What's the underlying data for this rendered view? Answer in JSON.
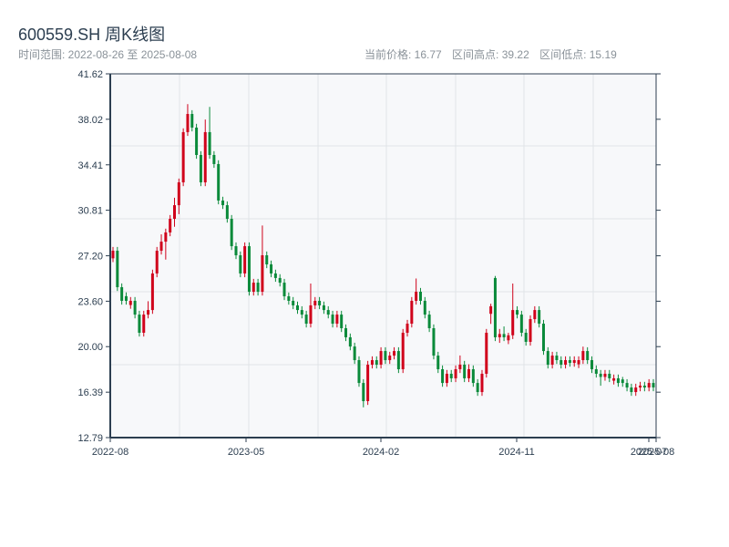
{
  "header": {
    "title": "600559.SH 周K线图",
    "range_label": "时间范围: 2022-08-26 至 2025-08-08",
    "current_price": "当前价格: 16.77",
    "range_high": "区间高点: 39.22",
    "range_low": "区间低点: 15.19"
  },
  "colors": {
    "up": "#d0021b",
    "down": "#0a8a3a",
    "axis": "#2c3e50",
    "plot_bg": "#f7f8fa",
    "grid": "#e1e4e8"
  },
  "chart_data": {
    "type": "candlestick",
    "title": "600559.SH 周K线图",
    "ylim": [
      12.79,
      41.62
    ],
    "yticks": [
      "12.79",
      "16.39",
      "20.00",
      "23.60",
      "27.20",
      "30.81",
      "34.41",
      "38.02",
      "41.62"
    ],
    "xticks": [
      "2022-08",
      "2023-05",
      "2024-02",
      "2024-11",
      "2025-07",
      "2025-08"
    ],
    "grid": true,
    "ohlc_order": [
      "open",
      "high",
      "low",
      "close"
    ],
    "candles": [
      [
        27.0,
        27.9,
        26.7,
        27.6
      ],
      [
        27.6,
        27.9,
        24.41,
        24.71
      ],
      [
        24.71,
        25.01,
        23.33,
        23.63
      ],
      [
        24.0,
        24.3,
        23.33,
        23.63
      ],
      [
        23.3,
        23.93,
        23.0,
        23.63
      ],
      [
        23.63,
        23.93,
        22.24,
        22.54
      ],
      [
        22.54,
        22.84,
        20.8,
        21.1
      ],
      [
        21.1,
        22.84,
        20.8,
        22.54
      ],
      [
        22.54,
        23.6,
        22.24,
        22.9
      ],
      [
        22.9,
        26.1,
        22.6,
        25.8
      ],
      [
        25.8,
        27.9,
        25.5,
        27.6
      ],
      [
        27.6,
        28.9,
        27.3,
        28.32
      ],
      [
        28.32,
        29.35,
        26.9,
        29.05
      ],
      [
        29.05,
        30.43,
        28.75,
        30.13
      ],
      [
        30.13,
        31.8,
        29.5,
        31.21
      ],
      [
        31.21,
        33.32,
        30.5,
        33.02
      ],
      [
        33.02,
        37.3,
        32.72,
        37.0
      ],
      [
        37.0,
        39.22,
        36.7,
        38.44
      ],
      [
        38.44,
        38.74,
        37.06,
        37.36
      ],
      [
        37.36,
        37.66,
        34.89,
        35.19
      ],
      [
        35.19,
        35.49,
        32.72,
        33.02
      ],
      [
        33.02,
        38.0,
        32.72,
        37.0
      ],
      [
        37.0,
        39.0,
        34.89,
        35.19
      ],
      [
        35.19,
        35.49,
        34.17,
        34.47
      ],
      [
        34.47,
        34.77,
        31.28,
        31.58
      ],
      [
        31.58,
        31.88,
        30.91,
        31.21
      ],
      [
        31.21,
        31.51,
        29.83,
        30.13
      ],
      [
        30.13,
        30.43,
        27.66,
        27.96
      ],
      [
        27.96,
        28.26,
        26.94,
        27.24
      ],
      [
        27.24,
        27.54,
        25.5,
        25.8
      ],
      [
        25.8,
        28.26,
        25.5,
        27.96
      ],
      [
        27.96,
        28.26,
        24.05,
        24.35
      ],
      [
        24.35,
        25.37,
        24.05,
        25.07
      ],
      [
        25.07,
        25.37,
        24.05,
        24.35
      ],
      [
        24.35,
        29.6,
        24.05,
        27.24
      ],
      [
        27.24,
        27.54,
        26.22,
        26.52
      ],
      [
        26.52,
        26.82,
        25.5,
        25.8
      ],
      [
        25.8,
        26.1,
        25.14,
        25.44
      ],
      [
        25.44,
        25.74,
        24.77,
        25.07
      ],
      [
        25.07,
        25.37,
        23.69,
        23.99
      ],
      [
        23.99,
        24.29,
        23.33,
        23.63
      ],
      [
        23.63,
        23.93,
        22.97,
        23.27
      ],
      [
        23.27,
        23.57,
        22.6,
        22.9
      ],
      [
        22.9,
        23.2,
        22.24,
        22.54
      ],
      [
        22.54,
        22.84,
        21.52,
        21.82
      ],
      [
        21.82,
        25.0,
        21.52,
        23.27
      ],
      [
        23.27,
        23.93,
        22.97,
        23.63
      ],
      [
        23.63,
        23.93,
        22.97,
        23.27
      ],
      [
        23.27,
        23.57,
        22.6,
        22.9
      ],
      [
        22.9,
        23.2,
        22.24,
        22.54
      ],
      [
        22.54,
        22.84,
        21.52,
        21.82
      ],
      [
        21.82,
        22.84,
        21.52,
        22.54
      ],
      [
        22.54,
        22.84,
        21.16,
        21.46
      ],
      [
        21.46,
        21.76,
        20.44,
        20.74
      ],
      [
        20.74,
        21.04,
        19.71,
        20.01
      ],
      [
        20.01,
        20.31,
        18.63,
        18.93
      ],
      [
        18.93,
        19.23,
        16.82,
        17.12
      ],
      [
        17.12,
        17.42,
        15.19,
        15.68
      ],
      [
        15.68,
        18.87,
        15.38,
        18.57
      ],
      [
        18.57,
        19.23,
        18.27,
        18.93
      ],
      [
        18.93,
        19.23,
        18.27,
        18.57
      ],
      [
        18.57,
        19.95,
        18.27,
        19.65
      ],
      [
        19.65,
        19.95,
        18.63,
        18.93
      ],
      [
        18.93,
        19.59,
        18.63,
        19.29
      ],
      [
        19.29,
        19.95,
        18.99,
        19.65
      ],
      [
        19.65,
        19.95,
        17.91,
        18.21
      ],
      [
        18.21,
        21.4,
        17.91,
        21.1
      ],
      [
        21.1,
        22.12,
        20.8,
        21.82
      ],
      [
        21.82,
        23.93,
        21.52,
        23.63
      ],
      [
        23.63,
        25.4,
        23.33,
        24.35
      ],
      [
        24.35,
        24.65,
        23.33,
        23.63
      ],
      [
        23.63,
        23.93,
        22.24,
        22.54
      ],
      [
        22.54,
        22.84,
        21.16,
        21.46
      ],
      [
        21.46,
        21.76,
        18.99,
        19.29
      ],
      [
        19.29,
        19.59,
        17.91,
        18.21
      ],
      [
        18.21,
        18.51,
        16.82,
        17.12
      ],
      [
        17.12,
        18.15,
        16.82,
        17.85
      ],
      [
        17.85,
        18.15,
        17.19,
        17.49
      ],
      [
        17.49,
        18.51,
        17.19,
        18.21
      ],
      [
        18.21,
        19.3,
        17.91,
        18.57
      ],
      [
        18.57,
        18.87,
        17.19,
        17.49
      ],
      [
        17.49,
        18.6,
        17.19,
        18.21
      ],
      [
        18.21,
        18.51,
        16.82,
        17.12
      ],
      [
        17.12,
        17.42,
        16.1,
        16.4
      ],
      [
        16.4,
        18.15,
        16.1,
        17.85
      ],
      [
        17.85,
        21.4,
        17.55,
        21.1
      ],
      [
        22.6,
        23.4,
        21.8,
        23.2
      ],
      [
        25.44,
        25.6,
        20.44,
        20.74
      ],
      [
        20.74,
        21.4,
        20.3,
        21.0
      ],
      [
        21.0,
        21.6,
        20.44,
        20.74
      ],
      [
        20.5,
        21.1,
        20.2,
        20.9
      ],
      [
        20.9,
        25.0,
        20.6,
        22.9
      ],
      [
        22.9,
        23.2,
        22.24,
        22.54
      ],
      [
        22.54,
        22.84,
        20.8,
        21.1
      ],
      [
        21.1,
        21.4,
        20.08,
        20.38
      ],
      [
        20.38,
        22.48,
        20.08,
        22.18
      ],
      [
        22.18,
        23.2,
        21.88,
        22.9
      ],
      [
        22.9,
        23.2,
        21.52,
        21.82
      ],
      [
        21.82,
        22.12,
        19.35,
        19.65
      ],
      [
        19.65,
        19.95,
        18.27,
        18.57
      ],
      [
        18.57,
        19.59,
        18.27,
        19.29
      ],
      [
        19.29,
        19.59,
        18.63,
        18.93
      ],
      [
        18.93,
        19.23,
        18.27,
        18.57
      ],
      [
        18.57,
        19.23,
        18.27,
        18.93
      ],
      [
        18.93,
        19.23,
        18.41,
        18.71
      ],
      [
        18.71,
        19.23,
        18.41,
        18.93
      ],
      [
        18.6,
        19.23,
        18.3,
        18.93
      ],
      [
        18.93,
        20.0,
        18.63,
        19.65
      ],
      [
        19.65,
        19.95,
        18.63,
        18.93
      ],
      [
        18.93,
        19.23,
        17.91,
        18.21
      ],
      [
        18.21,
        18.51,
        17.55,
        17.85
      ],
      [
        17.85,
        18.15,
        16.9,
        17.6
      ],
      [
        17.6,
        18.15,
        17.3,
        17.85
      ],
      [
        17.85,
        18.15,
        17.19,
        17.49
      ],
      [
        17.3,
        17.79,
        17.0,
        17.49
      ],
      [
        17.49,
        17.79,
        16.82,
        17.12
      ],
      [
        17.4,
        17.6,
        16.82,
        17.12
      ],
      [
        17.12,
        17.42,
        16.46,
        16.76
      ],
      [
        16.76,
        17.06,
        16.1,
        16.4
      ],
      [
        16.4,
        17.06,
        16.1,
        16.76
      ],
      [
        16.76,
        17.21,
        16.46,
        16.91
      ],
      [
        16.91,
        17.21,
        16.46,
        16.76
      ],
      [
        16.76,
        17.42,
        16.46,
        17.12
      ],
      [
        17.12,
        17.42,
        16.47,
        16.77
      ]
    ]
  }
}
